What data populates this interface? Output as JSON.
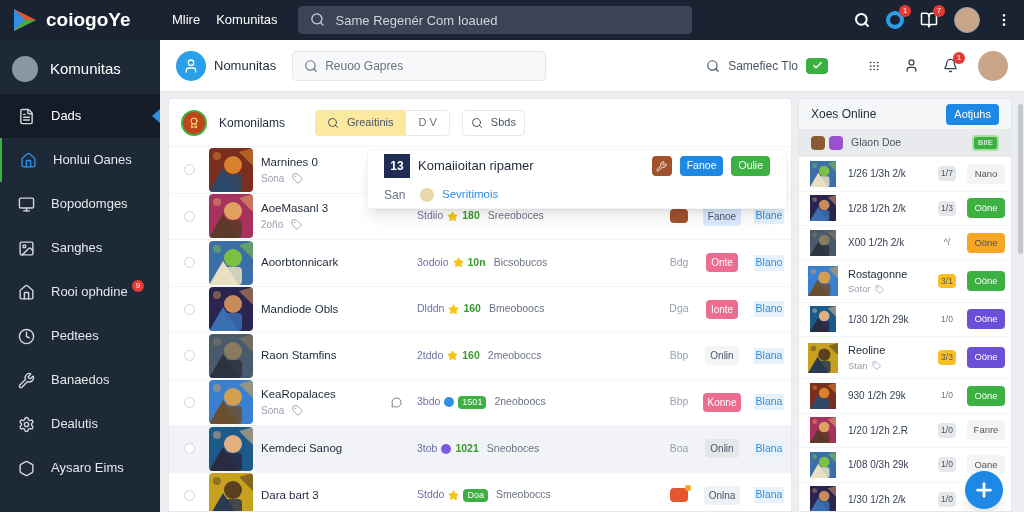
{
  "topbar": {
    "logo_text": "coiogoYe",
    "nav": [
      "Mlire",
      "Komunitas"
    ],
    "search": {
      "placeholder": "Same Regenér Com Ioaued"
    },
    "notifications": [
      {
        "kind": "circle",
        "badge": "1"
      },
      {
        "kind": "book",
        "badge": "7"
      }
    ]
  },
  "sidebar": {
    "profile": "Komunitas",
    "items": [
      {
        "label": "Dads",
        "selected": true,
        "active": false
      },
      {
        "label": "Honlui Oanes",
        "selected": false,
        "active": true
      },
      {
        "label": "Bopodomges",
        "selected": false,
        "active": false
      },
      {
        "label": "Sanghes",
        "selected": false,
        "active": false
      },
      {
        "label": "Rooi ophdine",
        "selected": false,
        "active": false,
        "badge": "9"
      },
      {
        "label": "Pedtees",
        "selected": false,
        "active": false
      },
      {
        "label": "Banaedos",
        "selected": false,
        "active": false
      },
      {
        "label": "Dealutis",
        "selected": false,
        "active": false
      },
      {
        "label": "Aysaro Eims",
        "selected": false,
        "active": false
      }
    ]
  },
  "header": {
    "title": "Nomunitas",
    "search": {
      "placeholder": "Reuoo Gapres"
    },
    "filter_label": "Samefiec Tlo",
    "notification_badge": "1"
  },
  "list": {
    "title": "Komonilams",
    "filter_button": "Greaitinis",
    "dropdown": "D V",
    "search_button": "Sbds",
    "rows": [
      {
        "name": "Marnines 0",
        "sub": "Sona",
        "selected": false
      },
      {
        "name": "AoeMasanl 3",
        "sub": "2oño",
        "selected": false,
        "meta": {
          "code": "Stdiio",
          "marker": {
            "kind": "star"
          },
          "score": {
            "text": "180",
            "kind": "plain"
          },
          "note": "Sreeoboces"
        },
        "tag": {
          "kind": "icon",
          "color": "#a0522d",
          "dot": false
        },
        "status": {
          "text": "Fanoe",
          "kind": "soft",
          "color": "#dbeafe"
        },
        "link": "Blane"
      },
      {
        "name": "Aoorbtonnicark",
        "selected": false,
        "meta": {
          "code": "3odoio",
          "marker": {
            "kind": "star"
          },
          "score": {
            "text": "10n",
            "kind": "plain"
          },
          "note": "Bicsobucos"
        },
        "tag": {
          "kind": "text",
          "text": "Bdg"
        },
        "status": {
          "text": "Onte",
          "kind": "filled",
          "color": "#ec6d8f"
        },
        "link": "Blano"
      },
      {
        "name": "Mandiode Obls",
        "selected": false,
        "meta": {
          "code": "Dlddn",
          "marker": {
            "kind": "star"
          },
          "score": {
            "text": "160",
            "kind": "plain"
          },
          "note": "Bmeoboocs"
        },
        "tag": {
          "kind": "text",
          "text": "Dga"
        },
        "status": {
          "text": "Ionte",
          "kind": "filled",
          "color": "#ec6d8f"
        },
        "link": "Blano"
      },
      {
        "name": "Raon Stamfins",
        "selected": false,
        "meta": {
          "code": "2tddo",
          "marker": {
            "kind": "star"
          },
          "score": {
            "text": "160",
            "kind": "plain"
          },
          "note": "2meoboccs"
        },
        "tag": {
          "kind": "text",
          "text": "Bbp"
        },
        "status": {
          "text": "Onlin",
          "kind": "soft",
          "color": "#f3f4f6"
        },
        "link": "Blana"
      },
      {
        "name": "KeaRopalaces",
        "sub": "Sona",
        "chat": true,
        "selected": false,
        "meta": {
          "code": "3bdo",
          "marker": {
            "kind": "dot",
            "color": "#2f8fe0"
          },
          "score": {
            "text": "1501",
            "kind": "badge"
          },
          "note": "2neoboocs"
        },
        "tag": {
          "kind": "text",
          "text": "Bbp"
        },
        "status": {
          "text": "Konne",
          "kind": "filled",
          "color": "#ec6d8f"
        },
        "link": "Blana"
      },
      {
        "name": "Kemdeci Sanog",
        "selected": true,
        "meta": {
          "code": "3tob",
          "marker": {
            "kind": "dot",
            "color": "#7a5ae0"
          },
          "score": {
            "text": "1021",
            "kind": "plain"
          },
          "note": "Sneoboces"
        },
        "tag": {
          "kind": "text",
          "text": "Boa"
        },
        "status": {
          "text": "Onlin",
          "kind": "soft",
          "color": "#e5e7eb"
        },
        "link": "Blana"
      },
      {
        "name": "Dara bart 3",
        "selected": false,
        "meta": {
          "code": "Stddo",
          "marker": {
            "kind": "star"
          },
          "score": {
            "text": "Doa",
            "kind": "badge"
          },
          "note": "Smeoboccs"
        },
        "tag": {
          "kind": "icon",
          "color": "#e4572e",
          "dot": true
        },
        "status": {
          "text": "Onlna",
          "kind": "soft",
          "color": "#eef2f7"
        },
        "link": "Blana"
      }
    ]
  },
  "popup": {
    "icon_text": "13",
    "title": "Komaiioitan ripamer",
    "label": "San",
    "link": "Sevritimois",
    "buttons": [
      {
        "text": "Fanoe",
        "color": "#1e88e5"
      },
      {
        "text": "Oulie",
        "color": "#3cb043"
      }
    ]
  },
  "online": {
    "title": "Xoes Online",
    "action": "Aotjuhs",
    "pinned": {
      "text": "Glaon Doe",
      "badge": "BIIE"
    },
    "rows": [
      {
        "text": "1/26 1/3h 2/k",
        "badge": {
          "text": "1/7",
          "kind": "pill",
          "color": "#e5e7eb"
        },
        "status": {
          "text": "Nano",
          "color": "#f3f4f6"
        }
      },
      {
        "text": "1/28 1/2h 2/k",
        "badge": {
          "text": "1/3",
          "kind": "pill",
          "color": "#e5e7eb"
        },
        "status": {
          "text": "Oöne",
          "color": "#3cb043"
        }
      },
      {
        "text": "X00 1/2h 2/k",
        "badge": {
          "text": "^/",
          "kind": "plain"
        },
        "status": {
          "text": "Oöne",
          "color": "#f5a623"
        }
      },
      {
        "title": "Rostagonne",
        "sub": "Sotor",
        "badge": {
          "text": "3/1",
          "kind": "pill",
          "color": "#fbbf24"
        },
        "status": {
          "text": "Oöne",
          "color": "#3cb043"
        }
      },
      {
        "text": "1/30 1/2h 29k",
        "badge": {
          "text": "1/0",
          "kind": "plain"
        },
        "status": {
          "text": "Oöne",
          "color": "#6b4fd8"
        }
      },
      {
        "title": "Reoline",
        "sub": "Stan",
        "badge": {
          "text": "3/3",
          "kind": "pill",
          "color": "#fbbf24"
        },
        "status": {
          "text": "Oöne",
          "color": "#6b4fd8"
        }
      },
      {
        "text": "930 1/2h 29k",
        "badge": {
          "text": "1/0",
          "kind": "plain"
        },
        "status": {
          "text": "Oöne",
          "color": "#3cb043"
        }
      },
      {
        "text": "1/20 1/2h 2.R",
        "badge": {
          "text": "1/0",
          "kind": "pill",
          "color": "#e5e7eb"
        },
        "status": {
          "text": "Fanre",
          "color": "#f3f4f6"
        }
      },
      {
        "text": "1/08 0/3h 29k",
        "badge": {
          "text": "1/0",
          "kind": "pill",
          "color": "#e5e7eb"
        },
        "status": {
          "text": "Oane",
          "color": "#f3f4f6"
        }
      },
      {
        "text": "1/30 1/2h 2/k",
        "badge": {
          "text": "1/0",
          "kind": "pill",
          "color": "#e5e7eb"
        }
      }
    ]
  }
}
